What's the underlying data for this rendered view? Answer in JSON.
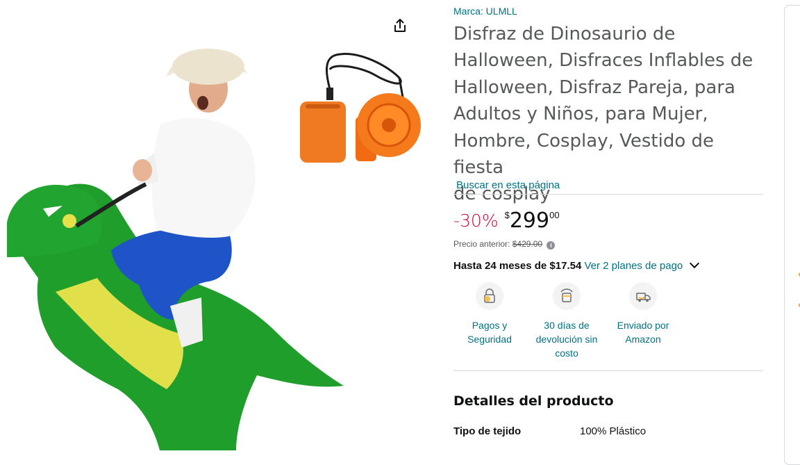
{
  "product_image": {
    "alt": "",
    "share_icon": "share-icon"
  },
  "brand": "Marca: ULMLL",
  "title_lines": [
    "Disfraz de Dinosaurio de",
    "Halloween, Disfraces Inflables de",
    "Halloween, Disfraz Pareja, para",
    "Adultos y Niños, para Mujer,",
    "Hombre, Cosplay, Vestido de fiesta",
    "de cosplay"
  ],
  "search_link": "Buscar en esta página",
  "price": {
    "discount": "-30%",
    "currency": "$",
    "whole": "299",
    "fraction": "00",
    "previous_label": "Precio anterior:",
    "previous_value": "$429.00"
  },
  "installments": {
    "bold": "Hasta 24 meses de $17.54",
    "link": "Ver 2 planes de pago"
  },
  "badges": [
    {
      "icon": "secure-payment-icon",
      "lines": [
        "Pagos y",
        "Seguridad"
      ]
    },
    {
      "icon": "return-box-icon",
      "lines": [
        "30 días de",
        "devolución sin",
        "costo"
      ]
    },
    {
      "icon": "delivery-truck-icon",
      "lines": [
        "Enviado por",
        "Amazon"
      ]
    }
  ],
  "details": {
    "title": "Detalles del producto",
    "rows": [
      {
        "key": "Tipo de tejido",
        "value": "100% Plástico"
      }
    ]
  },
  "colors": {
    "link": "#007185",
    "discount": "#cc0c39",
    "title": "#565959",
    "text": "#0f1111",
    "divider": "#d5d9d9"
  }
}
